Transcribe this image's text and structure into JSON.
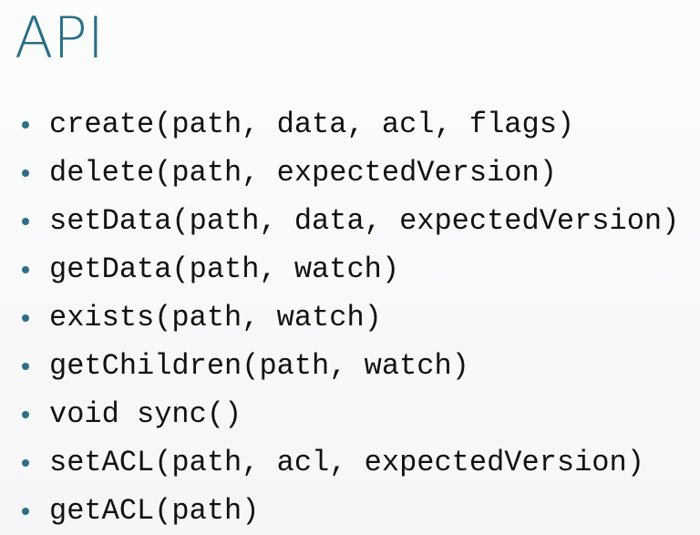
{
  "slide": {
    "title": "API",
    "bullets": [
      "create(path, data, acl, flags)",
      "delete(path, expectedVersion)",
      "setData(path, data, expectedVersion)",
      "getData(path, watch)",
      "exists(path, watch)",
      "getChildren(path, watch)",
      "void sync()",
      "setACL(path, acl, expectedVersion)",
      "getACL(path)"
    ]
  },
  "colors": {
    "title": "#2b6f85",
    "bullet_dot": "#2f6f84",
    "text": "#111111",
    "background": "#f7f8f9"
  },
  "icons": {
    "bullet": "bullet-dot-icon"
  }
}
